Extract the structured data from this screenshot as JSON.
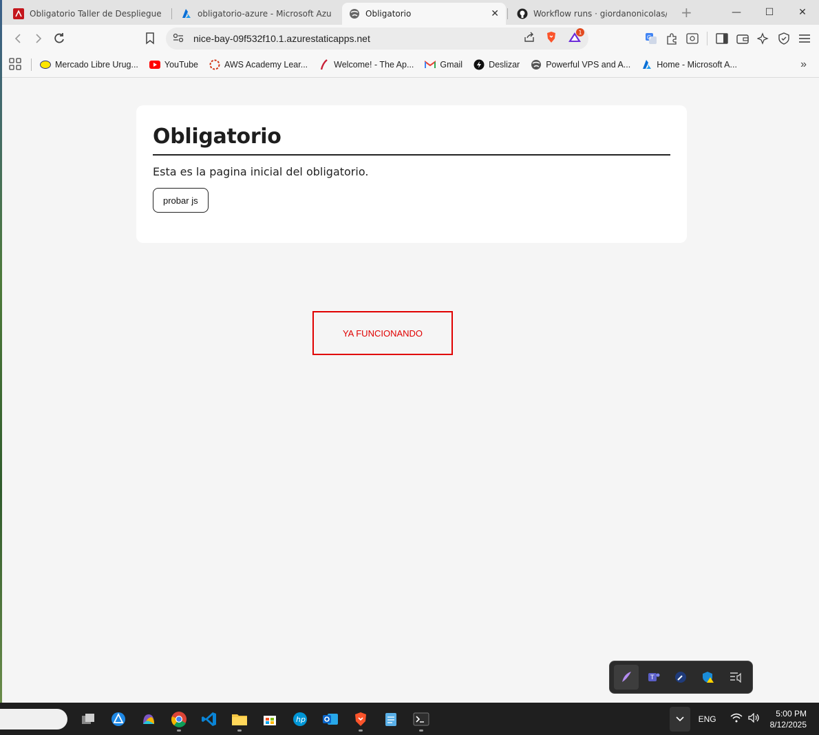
{
  "browser": {
    "tabs": [
      {
        "title": "Obligatorio Taller de Despliegue - Ju",
        "favicon": "pdf-icon"
      },
      {
        "title": "obligatorio-azure - Microsoft Azure",
        "favicon": "azure-icon"
      },
      {
        "title": "Obligatorio",
        "favicon": "globe-icon",
        "active": true
      },
      {
        "title": "Workflow runs · giordanonicolas/azu",
        "favicon": "github-icon"
      }
    ],
    "url": "nice-bay-09f532f10.1.azurestaticapps.net",
    "rewards_badge": "1",
    "bookmarks": [
      {
        "label": "Mercado Libre Urug...",
        "icon": "mercadolibre-icon"
      },
      {
        "label": "YouTube",
        "icon": "youtube-icon"
      },
      {
        "label": "AWS Academy Lear...",
        "icon": "aws-academy-icon"
      },
      {
        "label": "Welcome! - The Ap...",
        "icon": "feather-icon"
      },
      {
        "label": "Gmail",
        "icon": "gmail-icon"
      },
      {
        "label": "Deslizar",
        "icon": "deslizar-icon"
      },
      {
        "label": "Powerful VPS and A...",
        "icon": "globe-icon"
      },
      {
        "label": "Home - Microsoft A...",
        "icon": "azure-icon"
      }
    ]
  },
  "page": {
    "title": "Obligatorio",
    "description": "Esta es la pagina inicial del obligatorio.",
    "button_label": "probar js",
    "notice": "YA FUNCIONANDO"
  },
  "taskbar": {
    "language": "ENG",
    "time": "5:00 PM",
    "date": "8/12/2025"
  },
  "colors": {
    "notice_red": "#e00000",
    "taskbar": "#1f1f1f",
    "page_bg": "#f5f5f5"
  }
}
